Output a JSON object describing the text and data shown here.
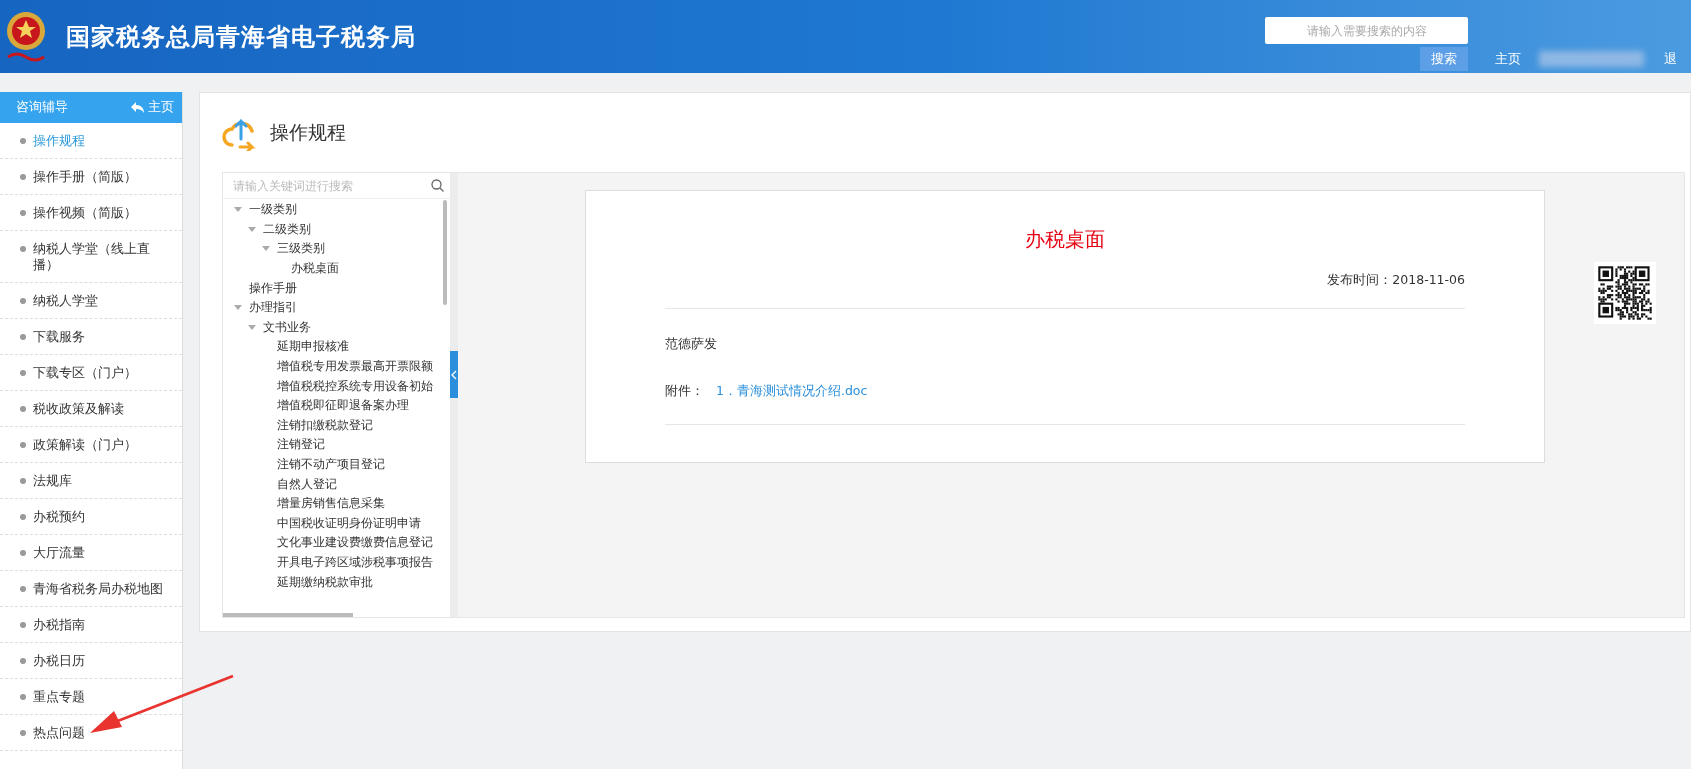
{
  "header": {
    "title": "国家税务总局青海省电子税务局",
    "search": {
      "placeholder": "请输入需要搜索的内容",
      "button": "搜索"
    },
    "nav": [
      "主页",
      "退"
    ]
  },
  "sidebar": {
    "title": "咨询辅导",
    "home": "主页",
    "items": [
      {
        "label": "操作规程",
        "selected": true
      },
      {
        "label": "操作手册（简版）",
        "selected": false
      },
      {
        "label": "操作视频（简版）",
        "selected": false
      },
      {
        "label": "纳税人学堂（线上直播）",
        "selected": false
      },
      {
        "label": "纳税人学堂",
        "selected": false
      },
      {
        "label": "下载服务",
        "selected": false
      },
      {
        "label": "下载专区（门户）",
        "selected": false
      },
      {
        "label": "税收政策及解读",
        "selected": false
      },
      {
        "label": "政策解读（门户）",
        "selected": false
      },
      {
        "label": "法规库",
        "selected": false
      },
      {
        "label": "办税预约",
        "selected": false
      },
      {
        "label": "大厅流量",
        "selected": false
      },
      {
        "label": "青海省税务局办税地图",
        "selected": false
      },
      {
        "label": "办税指南",
        "selected": false
      },
      {
        "label": "办税日历",
        "selected": false
      },
      {
        "label": "重点专题",
        "selected": false
      },
      {
        "label": "热点问题",
        "selected": false
      }
    ]
  },
  "page_title": "操作规程",
  "tree": {
    "search": {
      "placeholder": "请输入关键词进行搜索"
    },
    "nodes": [
      {
        "label": "一级类别",
        "expanded": true,
        "children": [
          {
            "label": "二级类别",
            "expanded": true,
            "children": [
              {
                "label": "三级类别",
                "expanded": true,
                "children": [
                  {
                    "label": "办税桌面"
                  }
                ]
              }
            ]
          }
        ]
      },
      {
        "label": "操作手册"
      },
      {
        "label": "办理指引",
        "expanded": true,
        "children": [
          {
            "label": "文书业务",
            "expanded": true,
            "children": [
              {
                "label": "延期申报核准"
              },
              {
                "label": "增值税专用发票最高开票限额"
              },
              {
                "label": "增值税税控系统专用设备初始"
              },
              {
                "label": "增值税即征即退备案办理"
              },
              {
                "label": "注销扣缴税款登记"
              },
              {
                "label": "注销登记"
              },
              {
                "label": "注销不动产项目登记"
              },
              {
                "label": "自然人登记"
              },
              {
                "label": "增量房销售信息采集"
              },
              {
                "label": "中国税收证明身份证明申请"
              },
              {
                "label": "文化事业建设费缴费信息登记"
              },
              {
                "label": "开具电子跨区域涉税事项报告"
              },
              {
                "label": "延期缴纳税款审批"
              }
            ]
          }
        ]
      }
    ]
  },
  "document": {
    "title": "办税桌面",
    "published": "发布时间：2018-11-06",
    "body": "范德萨发",
    "attachment_label": "附件：",
    "attachment": "1．青海测试情况介绍.doc"
  }
}
